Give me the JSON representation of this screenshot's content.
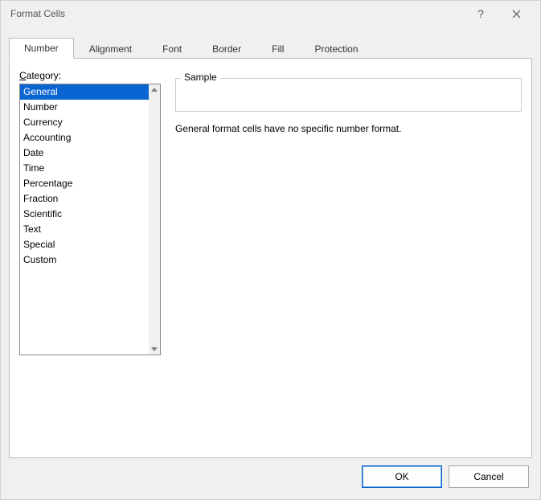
{
  "dialog": {
    "title": "Format Cells",
    "help_tooltip": "?",
    "close_tooltip": "×"
  },
  "tabs": [
    {
      "label": "Number",
      "active": true
    },
    {
      "label": "Alignment",
      "active": false
    },
    {
      "label": "Font",
      "active": false
    },
    {
      "label": "Border",
      "active": false
    },
    {
      "label": "Fill",
      "active": false
    },
    {
      "label": "Protection",
      "active": false
    }
  ],
  "number_tab": {
    "category_label_prefix": "C",
    "category_label_rest": "ategory:",
    "categories": [
      "General",
      "Number",
      "Currency",
      "Accounting",
      "Date",
      "Time",
      "Percentage",
      "Fraction",
      "Scientific",
      "Text",
      "Special",
      "Custom"
    ],
    "selected_index": 0,
    "sample_label": "Sample",
    "description": "General format cells have no specific number format."
  },
  "buttons": {
    "ok": "OK",
    "cancel": "Cancel"
  }
}
